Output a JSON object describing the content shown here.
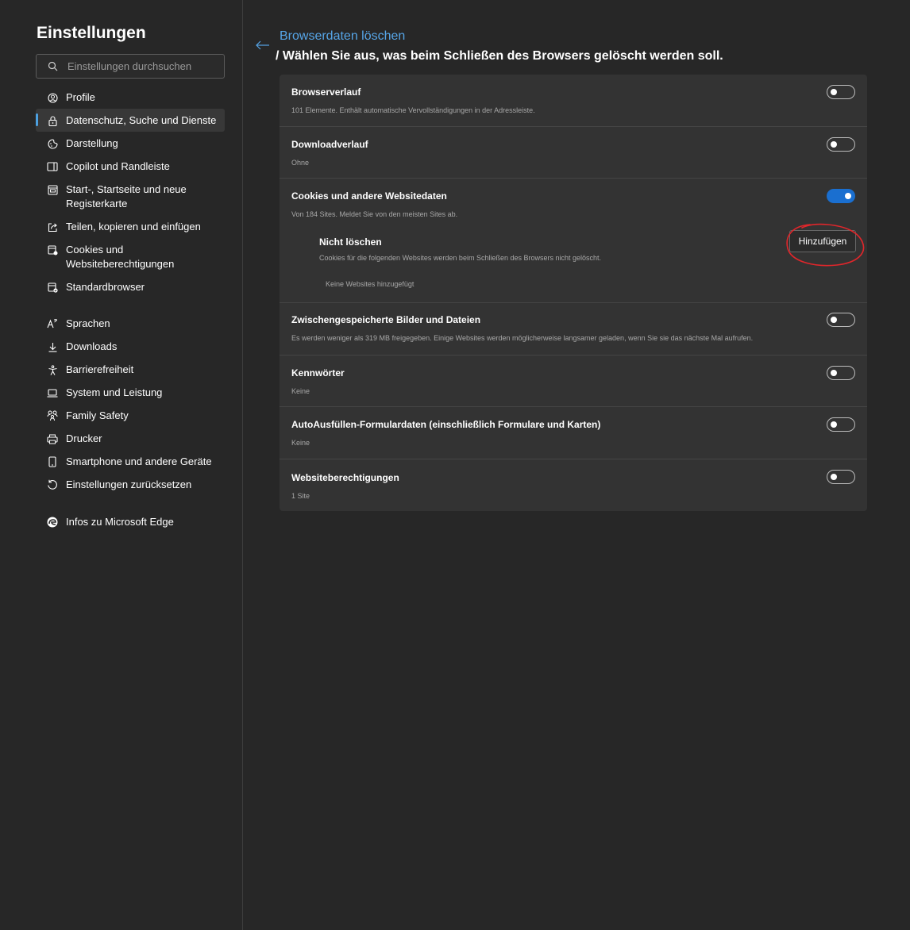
{
  "sidebar": {
    "title": "Einstellungen",
    "search_placeholder": "Einstellungen durchsuchen",
    "items": [
      {
        "label": "Profile",
        "icon": "profile-icon"
      },
      {
        "label": "Datenschutz, Suche und Dienste",
        "icon": "lock-icon",
        "active": true
      },
      {
        "label": "Darstellung",
        "icon": "appearance-icon"
      },
      {
        "label": "Copilot und Randleiste",
        "icon": "sidebar-panel-icon"
      },
      {
        "label": "Start-, Startseite und neue Registerkarte",
        "icon": "home-icon"
      },
      {
        "label": "Teilen, kopieren und einfügen",
        "icon": "share-icon"
      },
      {
        "label": "Cookies und Websiteberechtigungen",
        "icon": "cookies-icon"
      },
      {
        "label": "Standardbrowser",
        "icon": "default-browser-icon"
      },
      {
        "label": "Sprachen",
        "icon": "language-icon"
      },
      {
        "label": "Downloads",
        "icon": "download-icon"
      },
      {
        "label": "Barrierefreiheit",
        "icon": "accessibility-icon"
      },
      {
        "label": "System und Leistung",
        "icon": "laptop-icon"
      },
      {
        "label": "Family Safety",
        "icon": "family-icon"
      },
      {
        "label": "Drucker",
        "icon": "printer-icon"
      },
      {
        "label": "Smartphone und andere Geräte",
        "icon": "phone-icon"
      },
      {
        "label": "Einstellungen zurücksetzen",
        "icon": "reset-icon"
      },
      {
        "label": "Infos zu Microsoft Edge",
        "icon": "edge-logo-icon"
      }
    ]
  },
  "header": {
    "breadcrumb_link": "Browserdaten löschen",
    "title": "/ Wählen Sie aus, was beim Schließen des Browsers gelöscht werden soll."
  },
  "settings": [
    {
      "title": "Browserverlauf",
      "desc": "101 Elemente. Enthält automatische Vervollständigungen in der Adressleiste.",
      "enabled": false
    },
    {
      "title": "Downloadverlauf",
      "desc": "Ohne",
      "enabled": false
    },
    {
      "title": "Cookies und andere Websitedaten",
      "desc": "Von 184 Sites. Meldet Sie von den meisten Sites ab.",
      "enabled": true
    },
    {
      "title": "Zwischengespeicherte Bilder und Dateien",
      "desc": "Es werden weniger als 319 MB freigegeben. Einige Websites werden möglicherweise langsamer geladen, wenn Sie sie das nächste Mal aufrufen.",
      "enabled": false
    },
    {
      "title": "Kennwörter",
      "desc": "Keine",
      "enabled": false
    },
    {
      "title": "AutoAusfüllen-Formulardaten (einschließlich Formulare und Karten)",
      "desc": "Keine",
      "enabled": false
    },
    {
      "title": "Websiteberechtigungen",
      "desc": "1 Site",
      "enabled": false
    }
  ],
  "cookies_exceptions": {
    "title": "Nicht löschen",
    "desc": "Cookies für die folgenden Websites werden beim Schließen des Browsers nicht gelöscht.",
    "add_label": "Hinzufügen",
    "empty_text": "Keine Websites hinzugefügt"
  },
  "colors": {
    "accent": "#56a5e7",
    "toggle_on": "#1a6fd0",
    "annotation": "#e0262b"
  }
}
